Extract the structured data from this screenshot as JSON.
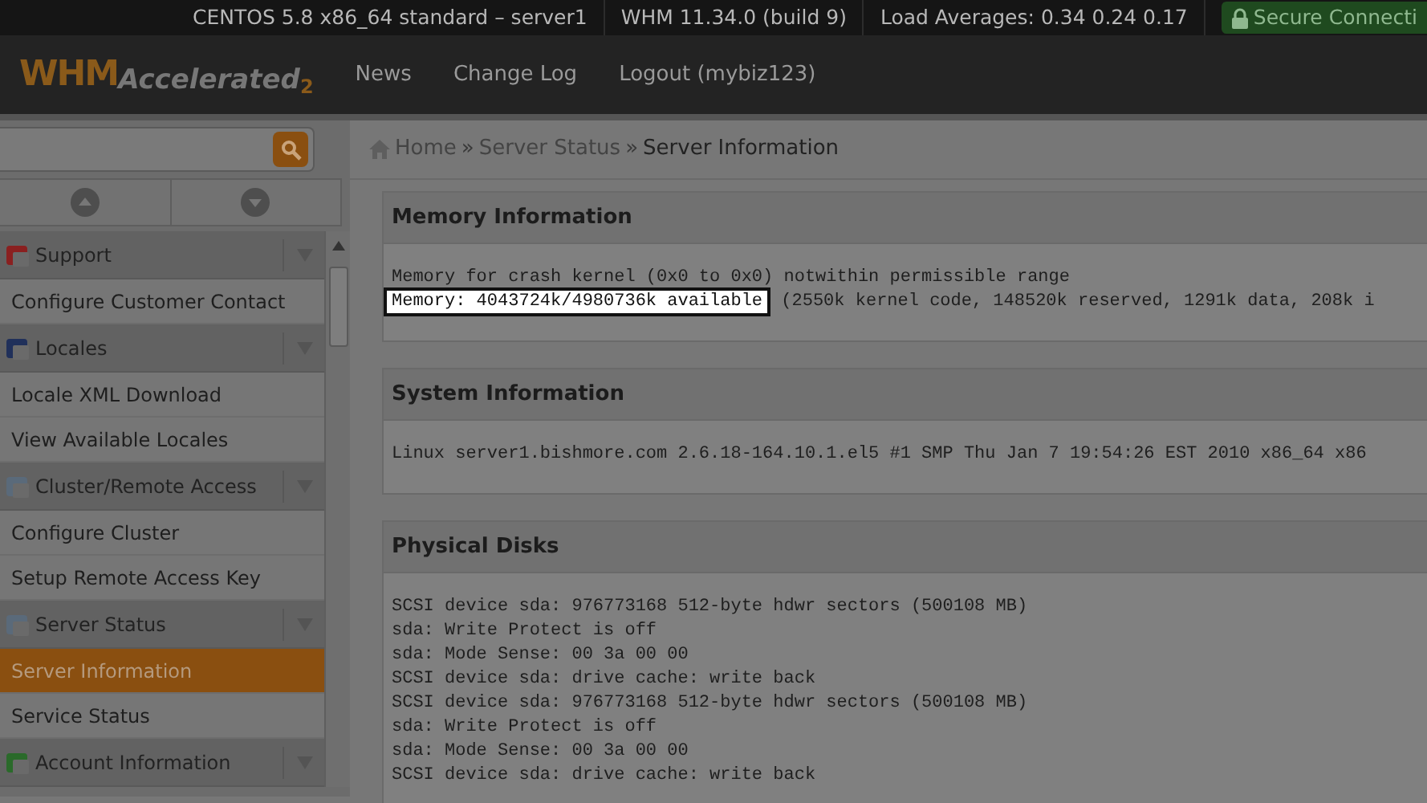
{
  "top_bar": {
    "items": [
      "CENTOS 5.8 x86_64 standard – server1",
      "WHM 11.34.0 (build 9)",
      "Load Averages: 0.34 0.24 0.17"
    ],
    "secure": "Secure Connecti"
  },
  "nav": {
    "logo": "WHM",
    "logo_sub": "Accelerated",
    "logo_version": "2",
    "links": [
      "News",
      "Change Log",
      "Logout (mybiz123)"
    ]
  },
  "sidebar": {
    "groups": [
      {
        "title": "Support",
        "items": [
          {
            "label": "Configure Customer Contact",
            "selected": false
          }
        ]
      },
      {
        "title": "Locales",
        "items": [
          {
            "label": "Locale XML Download",
            "selected": false
          },
          {
            "label": "View Available Locales",
            "selected": false
          }
        ]
      },
      {
        "title": "Cluster/Remote Access",
        "items": [
          {
            "label": "Configure Cluster",
            "selected": false
          },
          {
            "label": "Setup Remote Access Key",
            "selected": false
          }
        ]
      },
      {
        "title": "Server Status",
        "items": [
          {
            "label": "Server Information",
            "selected": true
          },
          {
            "label": "Service Status",
            "selected": false
          }
        ]
      },
      {
        "title": "Account Information"
      }
    ]
  },
  "breadcrumb": [
    {
      "text": "Home"
    },
    {
      "separator": "»",
      "text": "Server Status"
    },
    {
      "separator": "»",
      "text": "Server Information"
    }
  ],
  "panels": [
    {
      "title": "Memory Information",
      "lines": [
        {
          "segments": [
            {
              "text": "Memory for crash kernel (0x0 to 0x0) notwithin permissible range",
              "highlighted": false
            }
          ]
        },
        {
          "segments": [
            {
              "text": "Memory: 4043724k/4980736k available",
              "highlighted": true
            },
            {
              "text": "(2550k kernel code, 148520k reserved, 1291k data, 208k i",
              "highlighted": false
            }
          ]
        }
      ]
    },
    {
      "title": "System Information",
      "lines": [
        {
          "segments": [
            {
              "text": "Linux server1.bishmore.com 2.6.18-164.10.1.el5 #1 SMP Thu Jan 7 19:54:26 EST 2010 x86_64 x86",
              "highlighted": false
            }
          ]
        }
      ]
    },
    {
      "title": "Physical Disks",
      "lines": [
        {
          "segments": [
            {
              "text": "SCSI device sda: 976773168 512-byte hdwr sectors (500108 MB)",
              "highlighted": false
            }
          ]
        },
        {
          "segments": [
            {
              "text": "sda: Write Protect is off",
              "highlighted": false
            }
          ]
        },
        {
          "segments": [
            {
              "text": "sda: Mode Sense: 00 3a 00 00",
              "highlighted": false
            }
          ]
        },
        {
          "segments": [
            {
              "text": "SCSI device sda: drive cache: write back",
              "highlighted": false
            }
          ]
        },
        {
          "segments": [
            {
              "text": "SCSI device sda: 976773168 512-byte hdwr sectors (500108 MB)",
              "highlighted": false
            }
          ]
        },
        {
          "segments": [
            {
              "text": "sda: Write Protect is off",
              "highlighted": false
            }
          ]
        },
        {
          "segments": [
            {
              "text": "sda: Mode Sense: 00 3a 00 00",
              "highlighted": false
            }
          ]
        },
        {
          "segments": [
            {
              "text": "SCSI device sda: drive cache: write back",
              "highlighted": false
            }
          ]
        }
      ]
    }
  ]
}
